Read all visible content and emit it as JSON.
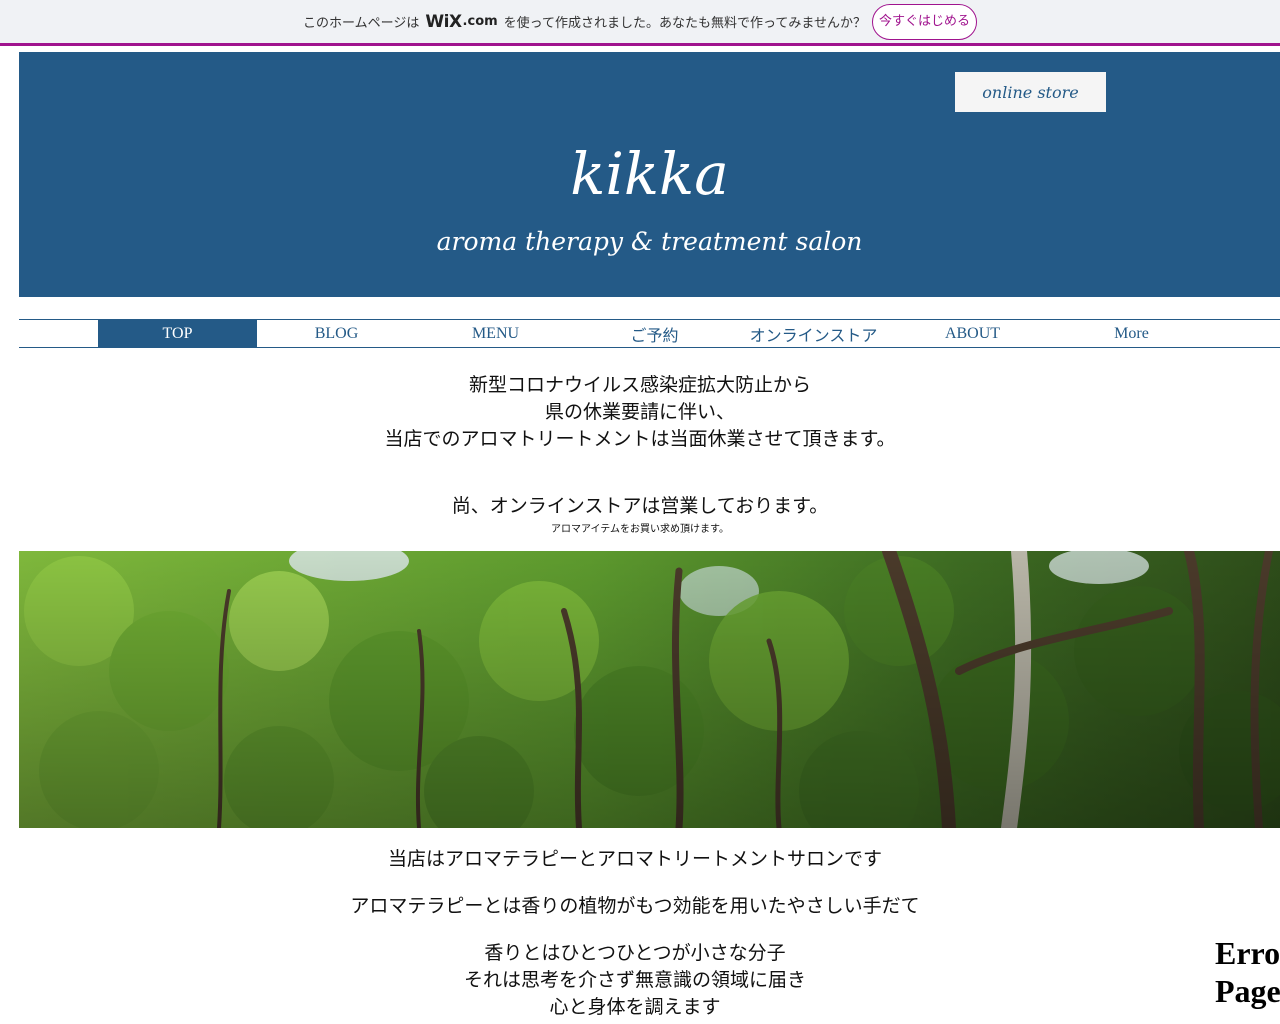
{
  "wix_bar": {
    "pre_text": "このホームページは",
    "logo_text": "WiX",
    "logo_suffix": ".com",
    "post_text": "を使って作成されました。あなたも無料で作ってみませんか？",
    "cta_label": "今すぐはじめる",
    "accent_color": "#a0138e"
  },
  "header": {
    "online_store_label": "online store",
    "title": "kikka",
    "tagline": "aroma therapy & treatment salon",
    "background_color": "#245a87"
  },
  "nav": {
    "items": [
      {
        "label": "TOP",
        "active": true
      },
      {
        "label": "BLOG",
        "active": false
      },
      {
        "label": "MENU",
        "active": false
      },
      {
        "label": "ご予約",
        "active": false
      },
      {
        "label": "オンラインストア",
        "active": false
      },
      {
        "label": "ABOUT",
        "active": false
      },
      {
        "label": "More",
        "active": false
      }
    ]
  },
  "notice": {
    "line1": "新型コロナウイルス感染症拡大防止から",
    "line2": "県の休業要請に伴い、",
    "line3": "当店でのアロマトリートメントは当面休業させて頂きます。",
    "line4": "尚、オンラインストアは営業しております。",
    "small": "アロマアイテムをお買い求め頂けます。"
  },
  "intro": {
    "p1": "当店はアロマテラピーとアロマトリートメントサロンです",
    "p2": "アロマテラピーとは香りの植物がもつ効能を用いたやさしい手だて",
    "p3a": "香りとはひとつひとつが小さな分子",
    "p3b": "それは思考を介さず無意識の領域に届き",
    "p3c": "心と身体を調えます"
  },
  "error_fragment": {
    "line1": "Erro",
    "line2": "Page"
  }
}
